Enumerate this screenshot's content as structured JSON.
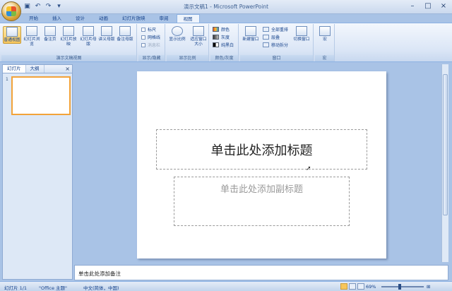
{
  "window": {
    "title": "演示文稿1 - Microsoft PowerPoint",
    "controls": [
      "–",
      "□",
      "×"
    ]
  },
  "tabs": [
    {
      "label": "开始"
    },
    {
      "label": "插入"
    },
    {
      "label": "设计"
    },
    {
      "label": "动画"
    },
    {
      "label": "幻灯片放映"
    },
    {
      "label": "审阅"
    },
    {
      "label": "视图"
    }
  ],
  "ribbon": {
    "views": {
      "label": "演示文稿视图",
      "buttons": [
        "普通视图",
        "幻灯片浏览",
        "备注页",
        "幻灯片放映",
        "幻灯片母版",
        "讲义母版",
        "备注母版"
      ]
    },
    "show_hide": {
      "label": "显示/隐藏",
      "items": [
        "标尺",
        "网格线",
        "消息栏"
      ]
    },
    "zoom": {
      "label": "显示比例",
      "buttons": [
        "显示比例",
        "适应窗口大小"
      ]
    },
    "color": {
      "label": "颜色/灰度",
      "items": [
        "颜色",
        "灰度",
        "纯黑白"
      ]
    },
    "window": {
      "label": "窗口",
      "new_window": "新建窗口",
      "items": [
        "全部重排",
        "层叠",
        "移动拆分"
      ],
      "switch": "切换窗口"
    },
    "macro": {
      "label": "宏",
      "button": "宏"
    }
  },
  "left_panel": {
    "tabs": [
      "幻灯片",
      "大纲"
    ],
    "slide_number": "1"
  },
  "slide": {
    "title_placeholder": "单击此处添加标题",
    "subtitle_placeholder": "单击此处添加副标题"
  },
  "notes": {
    "placeholder": "单击此处添加备注"
  },
  "status": {
    "slide": "幻灯片 1/1",
    "theme": "\"Office 主题\"",
    "language": "中文(简体，中国)",
    "zoom": "69%"
  }
}
